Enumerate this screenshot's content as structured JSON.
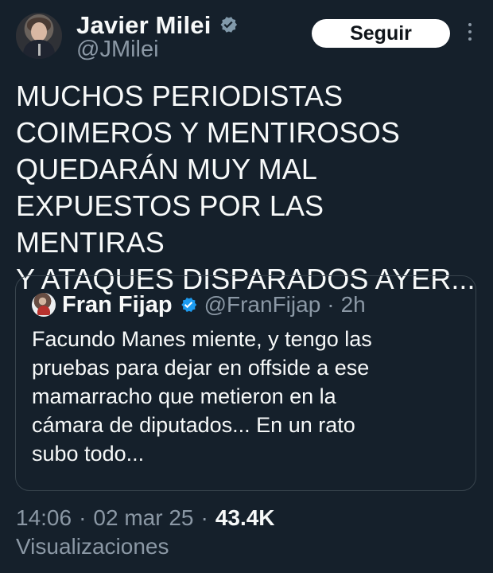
{
  "author": {
    "name": "Javier Milei",
    "handle": "@JMilei",
    "avatar_icon": "profile-photo"
  },
  "actions": {
    "follow_label": "Seguir",
    "more_icon": "more-vertical-icon"
  },
  "tweet": {
    "text": "MUCHOS PERIODISTAS\nCOIMEROS Y MENTIROSOS\nQUEDARÁN MUY MAL\nEXPUESTOS POR LAS MENTIRAS\nY ATAQUES DISPARADOS AYER..."
  },
  "quote": {
    "name": "Fran Fijap",
    "handle": "@FranFijap",
    "separator": "·",
    "time": "2h",
    "text": "Facundo Manes miente, y tengo las\npruebas para dejar en offside a ese\nmamarracho que metieron en la\ncámara de diputados... En un rato\nsubo todo..."
  },
  "meta": {
    "time": "14:06",
    "separator1": "·",
    "date": "02 mar 25",
    "separator2": "·",
    "views_count": "43.4K",
    "views_label": "Visualizaciones"
  },
  "colors": {
    "background": "#15202b",
    "primary_text": "#f7f9f9",
    "secondary_text": "#8b98a5",
    "verified": "#1d9bf0",
    "follow_button": "#ffffff"
  }
}
